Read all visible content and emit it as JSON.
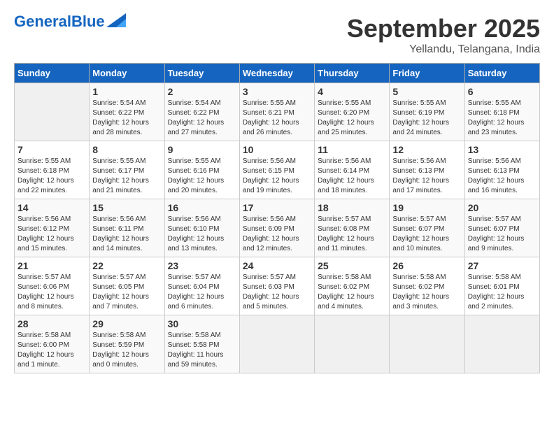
{
  "header": {
    "logo_line1": "General",
    "logo_line2": "Blue",
    "month": "September 2025",
    "location": "Yellandu, Telangana, India"
  },
  "days_of_week": [
    "Sunday",
    "Monday",
    "Tuesday",
    "Wednesday",
    "Thursday",
    "Friday",
    "Saturday"
  ],
  "weeks": [
    [
      {
        "day": "",
        "info": ""
      },
      {
        "day": "1",
        "info": "Sunrise: 5:54 AM\nSunset: 6:22 PM\nDaylight: 12 hours\nand 28 minutes."
      },
      {
        "day": "2",
        "info": "Sunrise: 5:54 AM\nSunset: 6:22 PM\nDaylight: 12 hours\nand 27 minutes."
      },
      {
        "day": "3",
        "info": "Sunrise: 5:55 AM\nSunset: 6:21 PM\nDaylight: 12 hours\nand 26 minutes."
      },
      {
        "day": "4",
        "info": "Sunrise: 5:55 AM\nSunset: 6:20 PM\nDaylight: 12 hours\nand 25 minutes."
      },
      {
        "day": "5",
        "info": "Sunrise: 5:55 AM\nSunset: 6:19 PM\nDaylight: 12 hours\nand 24 minutes."
      },
      {
        "day": "6",
        "info": "Sunrise: 5:55 AM\nSunset: 6:18 PM\nDaylight: 12 hours\nand 23 minutes."
      }
    ],
    [
      {
        "day": "7",
        "info": "Sunrise: 5:55 AM\nSunset: 6:18 PM\nDaylight: 12 hours\nand 22 minutes."
      },
      {
        "day": "8",
        "info": "Sunrise: 5:55 AM\nSunset: 6:17 PM\nDaylight: 12 hours\nand 21 minutes."
      },
      {
        "day": "9",
        "info": "Sunrise: 5:55 AM\nSunset: 6:16 PM\nDaylight: 12 hours\nand 20 minutes."
      },
      {
        "day": "10",
        "info": "Sunrise: 5:56 AM\nSunset: 6:15 PM\nDaylight: 12 hours\nand 19 minutes."
      },
      {
        "day": "11",
        "info": "Sunrise: 5:56 AM\nSunset: 6:14 PM\nDaylight: 12 hours\nand 18 minutes."
      },
      {
        "day": "12",
        "info": "Sunrise: 5:56 AM\nSunset: 6:13 PM\nDaylight: 12 hours\nand 17 minutes."
      },
      {
        "day": "13",
        "info": "Sunrise: 5:56 AM\nSunset: 6:13 PM\nDaylight: 12 hours\nand 16 minutes."
      }
    ],
    [
      {
        "day": "14",
        "info": "Sunrise: 5:56 AM\nSunset: 6:12 PM\nDaylight: 12 hours\nand 15 minutes."
      },
      {
        "day": "15",
        "info": "Sunrise: 5:56 AM\nSunset: 6:11 PM\nDaylight: 12 hours\nand 14 minutes."
      },
      {
        "day": "16",
        "info": "Sunrise: 5:56 AM\nSunset: 6:10 PM\nDaylight: 12 hours\nand 13 minutes."
      },
      {
        "day": "17",
        "info": "Sunrise: 5:56 AM\nSunset: 6:09 PM\nDaylight: 12 hours\nand 12 minutes."
      },
      {
        "day": "18",
        "info": "Sunrise: 5:57 AM\nSunset: 6:08 PM\nDaylight: 12 hours\nand 11 minutes."
      },
      {
        "day": "19",
        "info": "Sunrise: 5:57 AM\nSunset: 6:07 PM\nDaylight: 12 hours\nand 10 minutes."
      },
      {
        "day": "20",
        "info": "Sunrise: 5:57 AM\nSunset: 6:07 PM\nDaylight: 12 hours\nand 9 minutes."
      }
    ],
    [
      {
        "day": "21",
        "info": "Sunrise: 5:57 AM\nSunset: 6:06 PM\nDaylight: 12 hours\nand 8 minutes."
      },
      {
        "day": "22",
        "info": "Sunrise: 5:57 AM\nSunset: 6:05 PM\nDaylight: 12 hours\nand 7 minutes."
      },
      {
        "day": "23",
        "info": "Sunrise: 5:57 AM\nSunset: 6:04 PM\nDaylight: 12 hours\nand 6 minutes."
      },
      {
        "day": "24",
        "info": "Sunrise: 5:57 AM\nSunset: 6:03 PM\nDaylight: 12 hours\nand 5 minutes."
      },
      {
        "day": "25",
        "info": "Sunrise: 5:58 AM\nSunset: 6:02 PM\nDaylight: 12 hours\nand 4 minutes."
      },
      {
        "day": "26",
        "info": "Sunrise: 5:58 AM\nSunset: 6:02 PM\nDaylight: 12 hours\nand 3 minutes."
      },
      {
        "day": "27",
        "info": "Sunrise: 5:58 AM\nSunset: 6:01 PM\nDaylight: 12 hours\nand 2 minutes."
      }
    ],
    [
      {
        "day": "28",
        "info": "Sunrise: 5:58 AM\nSunset: 6:00 PM\nDaylight: 12 hours\nand 1 minute."
      },
      {
        "day": "29",
        "info": "Sunrise: 5:58 AM\nSunset: 5:59 PM\nDaylight: 12 hours\nand 0 minutes."
      },
      {
        "day": "30",
        "info": "Sunrise: 5:58 AM\nSunset: 5:58 PM\nDaylight: 11 hours\nand 59 minutes."
      },
      {
        "day": "",
        "info": ""
      },
      {
        "day": "",
        "info": ""
      },
      {
        "day": "",
        "info": ""
      },
      {
        "day": "",
        "info": ""
      }
    ]
  ]
}
